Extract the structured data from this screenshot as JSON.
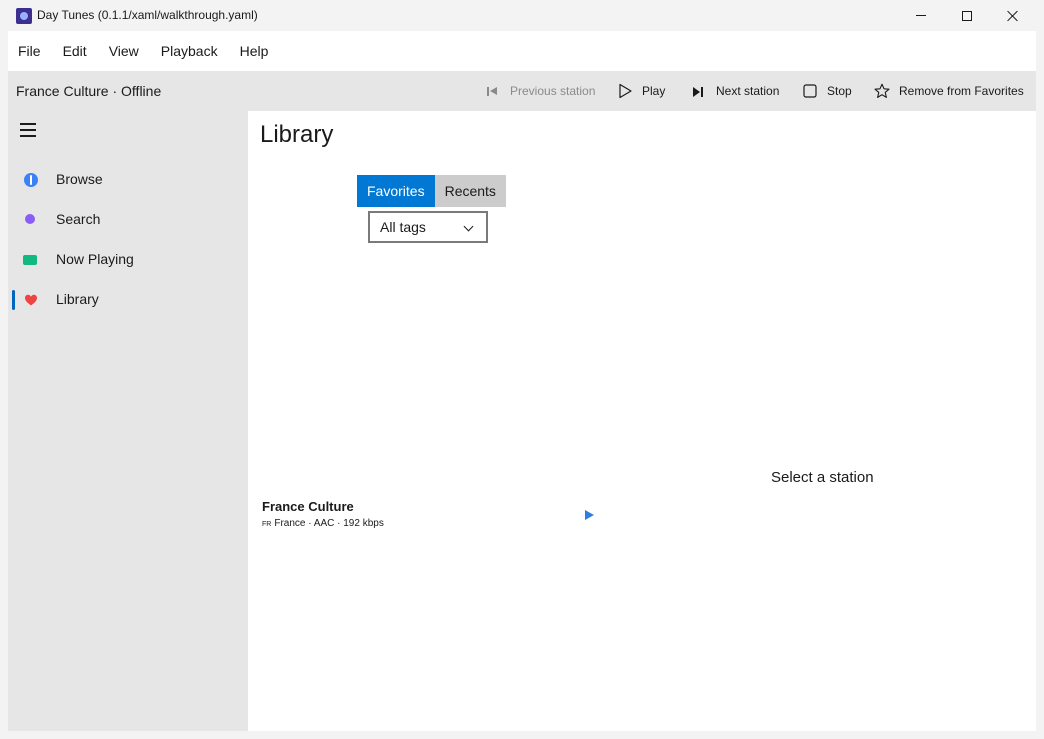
{
  "window": {
    "title": "Day Tunes (0.1.1/xaml/walkthrough.yaml)"
  },
  "menu": [
    "File",
    "Edit",
    "View",
    "Playback",
    "Help"
  ],
  "command_bar": {
    "status": "France Culture · Offline",
    "previous_label": "Previous station",
    "play_label": "Play",
    "next_label": "Next station",
    "stop_label": "Stop",
    "favorite_label": "Remove from Favorites"
  },
  "sidebar": {
    "items": [
      {
        "label": "Browse",
        "icon": "compass-icon",
        "color": "#3b82f6"
      },
      {
        "label": "Search",
        "icon": "search-icon",
        "color": "#8b5cf6"
      },
      {
        "label": "Now Playing",
        "icon": "now-playing-icon",
        "color": "#10b981"
      },
      {
        "label": "Library",
        "icon": "heart-icon",
        "color": "#ef4444",
        "selected": true
      }
    ]
  },
  "main": {
    "title": "Library",
    "tabs": [
      {
        "label": "Favorites",
        "active": true
      },
      {
        "label": "Recents",
        "active": false
      }
    ],
    "tag_filter": {
      "value": "All tags"
    },
    "stations": [
      {
        "name": "France Culture",
        "flag": "FR",
        "meta": "France · AAC · 192 kbps"
      }
    ],
    "detail_placeholder": "Select a station"
  },
  "colors": {
    "accent": "#0078d4",
    "play_icon": "#2f7de1"
  }
}
